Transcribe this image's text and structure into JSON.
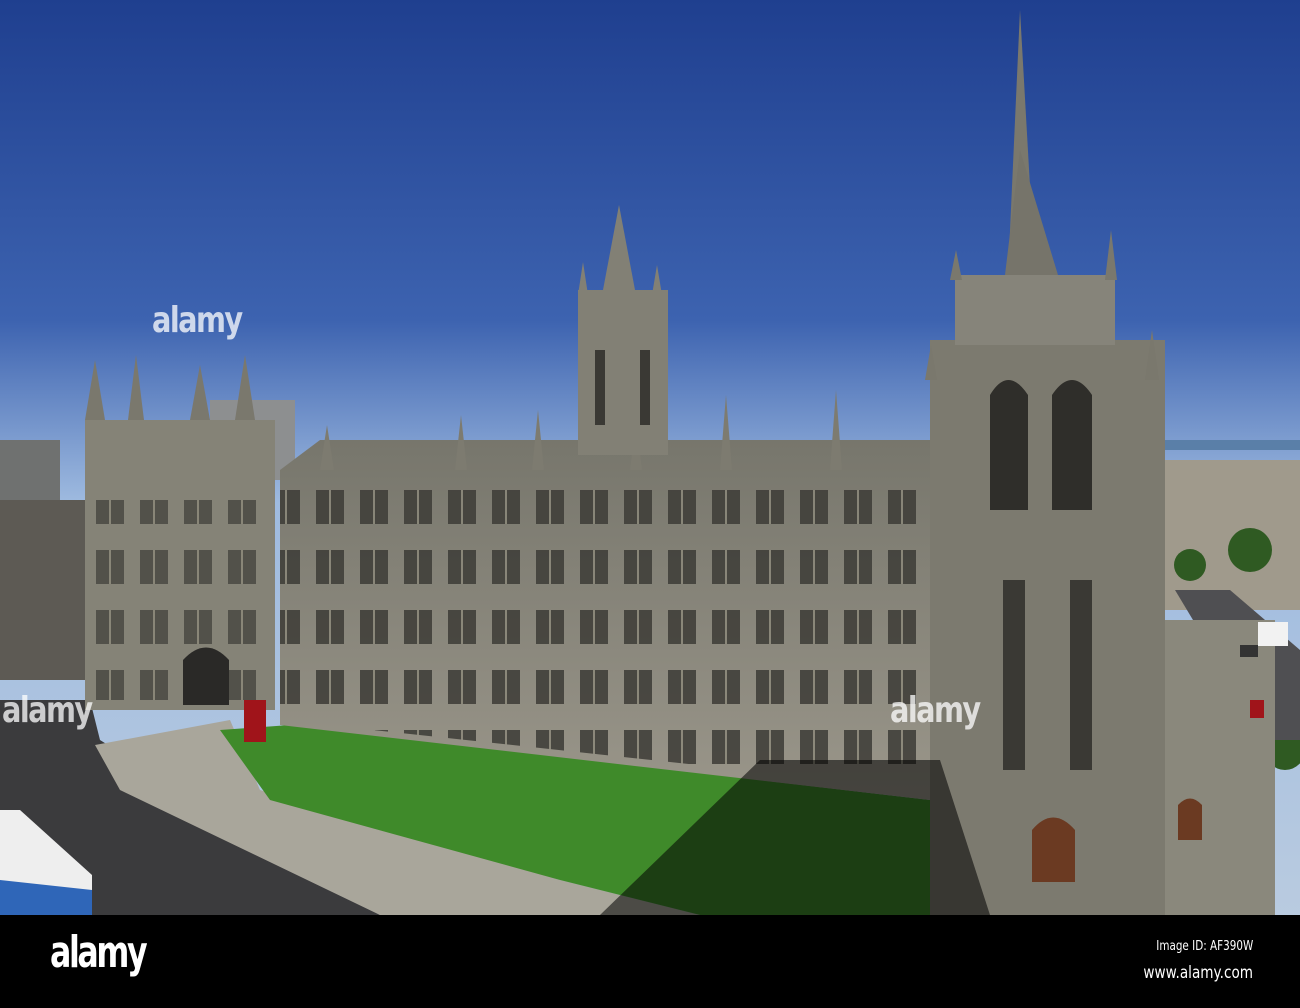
{
  "photo": {
    "subject": "Granite gothic building with spired towers under blue sky"
  },
  "watermark": {
    "text": "alamy"
  },
  "footer": {
    "logo": "alamy",
    "image_id": "Image ID: AF390W",
    "website": "www.alamy.com"
  },
  "colors": {
    "sky_top": "#1f3f8f",
    "sky_horizon": "#9fbbe0",
    "granite": "#8a8779",
    "grass": "#3f8a2a",
    "footer": "#000000"
  }
}
